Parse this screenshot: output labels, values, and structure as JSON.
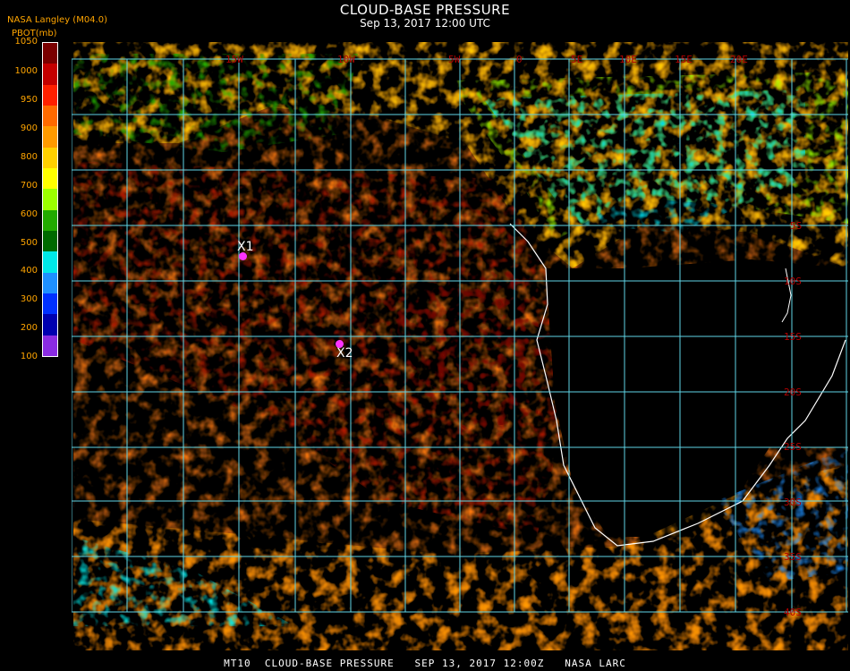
{
  "header": {
    "title": "CLOUD-BASE PRESSURE",
    "subtitle": "Sep 13, 2017 12:00 UTC",
    "agency": "NASA Langley (M04.0)",
    "unit_label": "PBOT(mb)"
  },
  "colorbar": {
    "ticks": [
      "1050",
      "1000",
      "950",
      "900",
      "800",
      "700",
      "600",
      "500",
      "400",
      "300",
      "200",
      "100"
    ],
    "colors": [
      "#7a0000",
      "#c40000",
      "#ff2000",
      "#ff6a00",
      "#ff9a00",
      "#ffd000",
      "#ffff00",
      "#9cff00",
      "#22aa00",
      "#006a00",
      "#00e8e8",
      "#1e90ff",
      "#0030ff",
      "#0000b0",
      "#8a2be2"
    ]
  },
  "map": {
    "lat_labels": [
      "5S",
      "10S",
      "15S",
      "20S",
      "25S",
      "30S",
      "35S",
      "40S"
    ],
    "lon_labels": [
      "15W",
      "10W",
      "5W",
      "0",
      "5E",
      "10E",
      "15E",
      "20E"
    ],
    "markers": [
      {
        "label": "X1"
      },
      {
        "label": "X2"
      }
    ],
    "colors": {
      "grid": "#5fd5e6",
      "coast": "#ffffff",
      "background": "#000000",
      "lat_label": "#b30000"
    }
  },
  "footer": {
    "text": "MT10  CLOUD-BASE PRESSURE   SEP 13, 2017 12:00Z   NASA LARC"
  }
}
